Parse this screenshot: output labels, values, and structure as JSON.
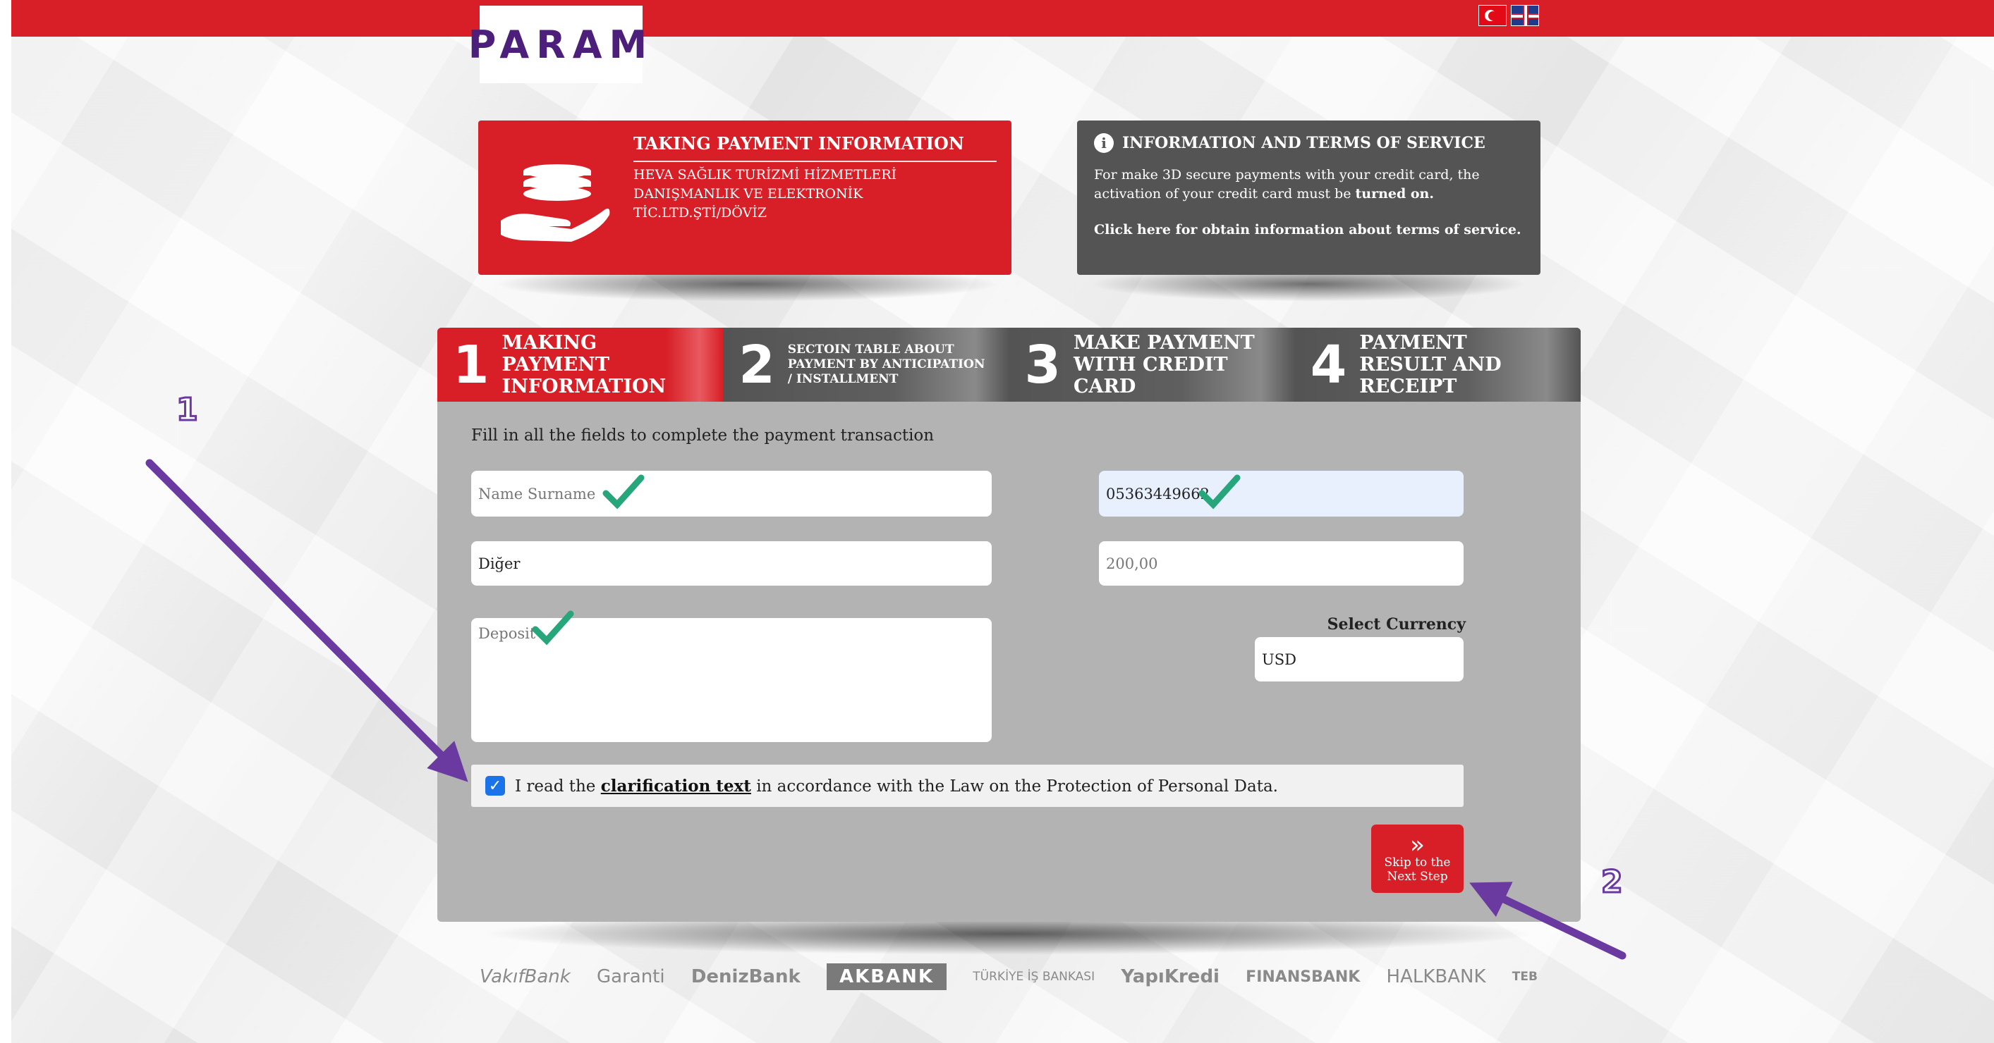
{
  "header": {
    "logo_text": "PARAM",
    "languages": [
      "Türkçe",
      "English"
    ]
  },
  "payment_card": {
    "title": "TAKING PAYMENT INFORMATION",
    "merchant": "HEVA SAĞLIK TURİZMİ HİZMETLERİ DANIŞMANLIK VE ELEKTRONİK TİC.LTD.ŞTİ/DÖVİZ",
    "icon": "hand-holding-money-icon"
  },
  "info_card": {
    "title": "INFORMATION AND TERMS OF SERVICE",
    "icon": "info-icon",
    "text_before": "For make 3D secure payments with your credit card, the activation of your credit card must be ",
    "text_bold": "turned on.",
    "terms_link": "Click here for obtain information about terms of service."
  },
  "steps": [
    {
      "num": "1",
      "label": "MAKING PAYMENT INFORMATION",
      "active": true
    },
    {
      "num": "2",
      "label": "SECTOIN TABLE ABOUT PAYMENT BY ANTICIPATION / INSTALLMENT",
      "active": false
    },
    {
      "num": "3",
      "label": "MAKE PAYMENT WITH CREDIT CARD",
      "active": false
    },
    {
      "num": "4",
      "label": "PAYMENT RESULT AND RECEIPT",
      "active": false
    }
  ],
  "form": {
    "intro": "Fill in all the fields to complete the payment transaction",
    "name": {
      "placeholder": "Name Surname",
      "value": ""
    },
    "phone": {
      "value": "05363449662"
    },
    "type": {
      "value": "Diğer"
    },
    "amount": {
      "placeholder": "200,00"
    },
    "description": {
      "placeholder": "Deposit"
    },
    "currency": {
      "label": "Select Currency",
      "value": "USD"
    },
    "agreement": {
      "checked": true,
      "before": "I read the ",
      "link": "clarification text",
      "after": " in accordance with the Law on the Protection of Personal Data."
    },
    "next_button": {
      "line1": "Skip to the",
      "line2": "Next Step"
    }
  },
  "banks": [
    "VakıfBank",
    "Garanti",
    "DenizBank",
    "AKBANK",
    "TÜRKİYE İŞ BANKASI",
    "YapıKredi",
    "FINANSBANK",
    "HALKBANK",
    "TEB"
  ],
  "annotations": {
    "marker1": "1",
    "marker2": "2"
  },
  "colors": {
    "brand_red": "#d81e26",
    "dark_gray": "#545454",
    "panel_gray": "#b3b3b3",
    "logo_purple": "#4b1f7a",
    "check_green": "#26a67a",
    "arrow_purple": "#6a3aa0"
  }
}
